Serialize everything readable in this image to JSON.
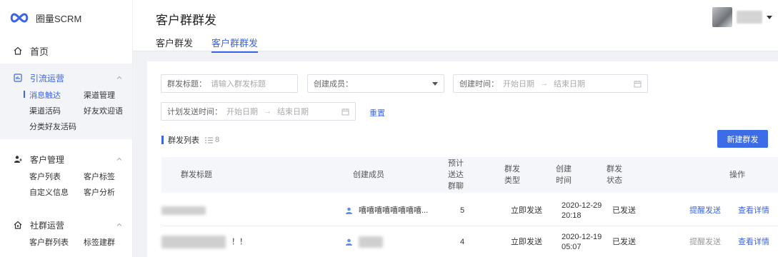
{
  "brand": {
    "name": "圈量SCRM",
    "accent": "#3c64e6"
  },
  "sidebar": {
    "home": "首页",
    "groups": [
      {
        "label": "引流运营",
        "icon": "campaign-icon",
        "active": true,
        "items": [
          "消息触达",
          "渠道管理",
          "渠道活码",
          "好友欢迎语",
          "分类好友活码"
        ],
        "active_item": "消息触达"
      },
      {
        "label": "客户管理",
        "icon": "user-manage-icon",
        "items": [
          "客户列表",
          "客户标签",
          "自定义信息",
          "客户分析"
        ]
      },
      {
        "label": "社群运营",
        "icon": "community-icon",
        "items": [
          "客户群列表",
          "标签建群"
        ]
      }
    ]
  },
  "header": {
    "title": "客户群群发",
    "tabs": [
      {
        "label": "客户群发"
      },
      {
        "label": "客户群群发",
        "active": true
      }
    ]
  },
  "filters": {
    "title": {
      "label": "群发标题：",
      "placeholder": "请输入群发标题"
    },
    "creator": {
      "label": "创建成员："
    },
    "created_time": {
      "label": "创建时间：",
      "start": "开始日期",
      "end": "结束日期",
      "arrow": "→"
    },
    "plan_time": {
      "label": "计划发送时间：",
      "start": "开始日期",
      "end": "结束日期",
      "arrow": "→"
    },
    "reset": "重置"
  },
  "list": {
    "title": "群发列表",
    "count": "8",
    "new_button": "新建群发"
  },
  "table": {
    "headers": {
      "title": "群发标题",
      "creator": "创建成员",
      "est": [
        "预计",
        "送达",
        "群聊"
      ],
      "type": [
        "群发",
        "类型"
      ],
      "created": [
        "创建",
        "时间"
      ],
      "status": [
        "群发",
        "状态"
      ],
      "ops": "操作"
    },
    "rows": [
      {
        "title_suffix": "",
        "creator": "嘻嘻嘻嘻嘻嘻嘻嘻...",
        "count": "5",
        "type": "立即发送",
        "date": "2020-12-29",
        "time": "20:18",
        "status": "已发送",
        "remind": "提醒发送",
        "detail": "查看详情"
      },
      {
        "title_suffix": "！！",
        "creator": "",
        "count": "4",
        "type": "立即发送",
        "date": "2020-12-19",
        "time": "05:07",
        "status": "已发送",
        "remind": "提醒发送",
        "detail": "查看详情"
      }
    ]
  }
}
